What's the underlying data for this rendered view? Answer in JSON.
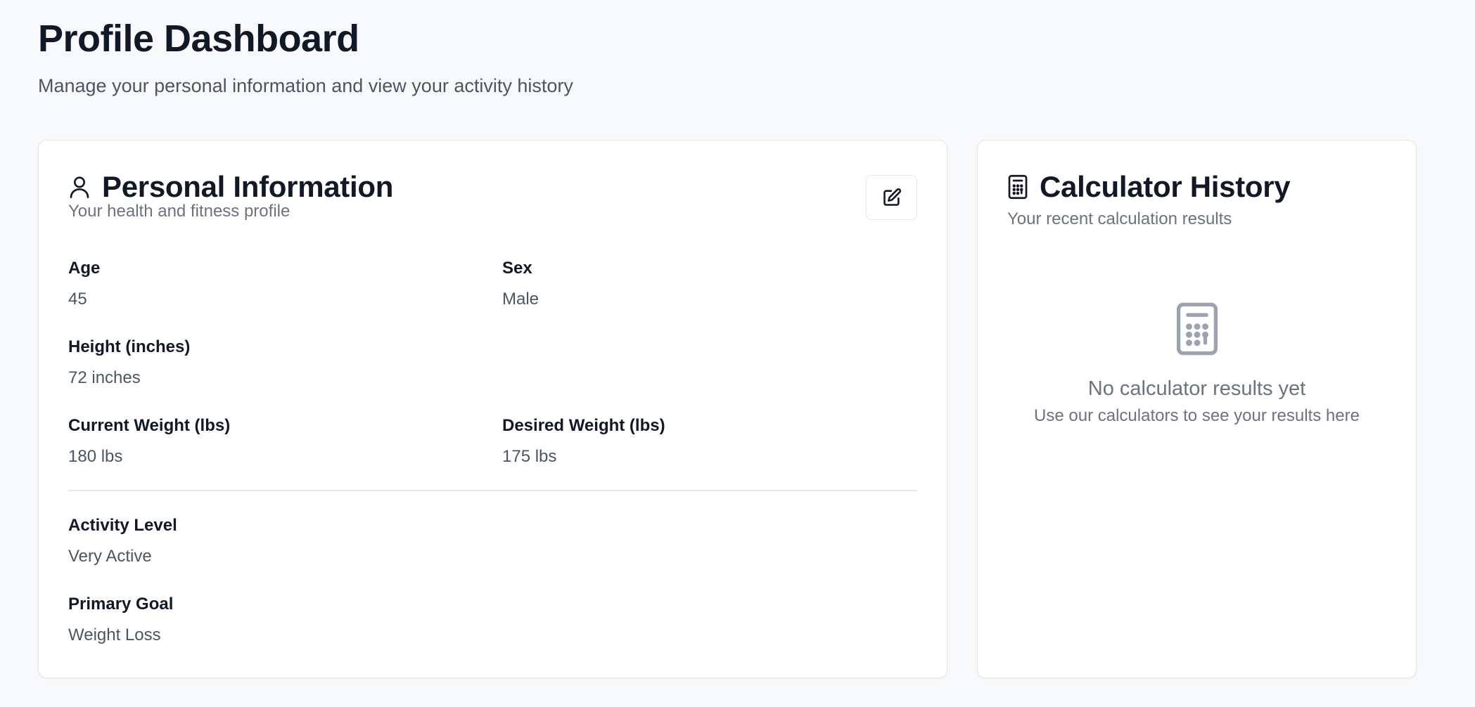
{
  "header": {
    "title": "Profile Dashboard",
    "subtitle": "Manage your personal information and view your activity history"
  },
  "personal": {
    "icon": "user-icon",
    "title": "Personal Information",
    "description": "Your health and fitness profile",
    "edit_icon": "edit-icon",
    "fields": {
      "age": {
        "label": "Age",
        "value": "45"
      },
      "sex": {
        "label": "Sex",
        "value": "Male"
      },
      "height": {
        "label": "Height (inches)",
        "value": "72 inches"
      },
      "current_weight": {
        "label": "Current Weight (lbs)",
        "value": "180 lbs"
      },
      "desired_weight": {
        "label": "Desired Weight (lbs)",
        "value": "175 lbs"
      },
      "activity_level": {
        "label": "Activity Level",
        "value": "Very Active"
      },
      "primary_goal": {
        "label": "Primary Goal",
        "value": "Weight Loss"
      }
    }
  },
  "history": {
    "icon": "calculator-icon",
    "title": "Calculator History",
    "description": "Your recent calculation results",
    "empty_icon": "calculator-icon",
    "empty_title": "No calculator results yet",
    "empty_description": "Use our calculators to see your results here"
  },
  "colors": {
    "background": "#f8f9fb",
    "card": "#ffffff",
    "border": "#e5e7eb",
    "text_primary": "#111827",
    "text_secondary": "#4b5563",
    "text_muted": "#6b7280",
    "icon_muted": "#9ca3af"
  }
}
